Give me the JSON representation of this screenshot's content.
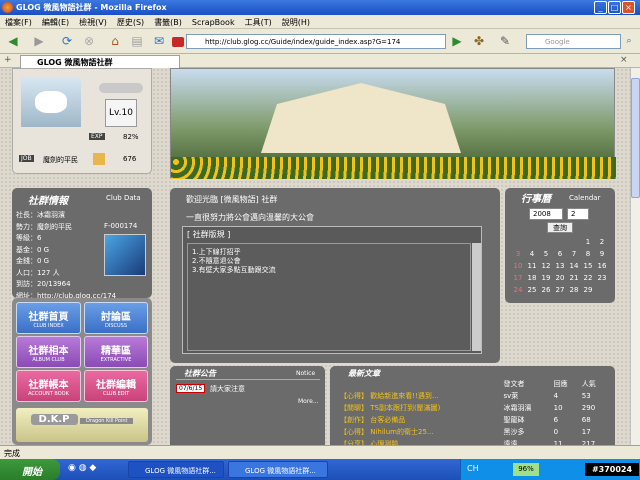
{
  "window": {
    "title": "GLOG 微風物語社群 - Mozilla Firefox",
    "min": "_",
    "max": "□",
    "close": "×"
  },
  "menu": [
    "檔案(F)",
    "編輯(E)",
    "檢視(V)",
    "歷史(S)",
    "書籤(B)",
    "ScrapBook",
    "工具(T)",
    "說明(H)"
  ],
  "nav": {
    "url": "http://club.glog.cc/Guide/index/guide_index.asp?G=174",
    "search_placeholder": "Google"
  },
  "tab": {
    "label": "GLOG 微風物語社群"
  },
  "profile": {
    "level": "Lv.10",
    "exp_label": "EXP",
    "exp_value": "82%",
    "job_label": "JOB",
    "job_name": "魔劍的平民",
    "job_value": "676"
  },
  "club_info": {
    "title": "社群情報",
    "title_en": "Club Data",
    "rows": [
      "社長：冰霜羽濱",
      "勢力：魔劍的平民",
      "等級：6",
      "基金：0 G",
      "金錢：0 G",
      "人口：127 人",
      "到訪：20/13964",
      "網址：http://club.glog.cc/174"
    ],
    "faction_id": "F-000174"
  },
  "nav_buttons": [
    {
      "big": "社群首頁",
      "small": "CLUB INDEX"
    },
    {
      "big": "討論區",
      "small": "DISCUSS"
    },
    {
      "big": "社群相本",
      "small": "ALBUM CLUB"
    },
    {
      "big": "精華區",
      "small": "EXTRACTIVE"
    },
    {
      "big": "社群帳本",
      "small": "ACCOUNT BOOK"
    },
    {
      "big": "社群編輯",
      "small": "CLUB EDIT"
    }
  ],
  "dkp": {
    "title": "D.K.P",
    "sub": "Dragon Kill Point"
  },
  "welcome": {
    "title": "歡迎光臨 [微風物語] 社群",
    "slogan": "一直很努力將公會邁向溫馨的大公會",
    "board_title": "[ 社群版規 ]",
    "rules": [
      "1.上下線打招乎",
      "2.不隨意退公會",
      "3.有壁大家多點互動跟交流"
    ]
  },
  "calendar": {
    "title": "行事曆",
    "title_en": "Calendar",
    "year": "2008",
    "month": "2",
    "query_btn": "查詢",
    "weeks": [
      [
        "",
        "",
        "",
        "",
        "",
        "1",
        "2"
      ],
      [
        "3",
        "4",
        "5",
        "6",
        "7",
        "8",
        "9"
      ],
      [
        "10",
        "11",
        "12",
        "13",
        "14",
        "15",
        "16"
      ],
      [
        "17",
        "18",
        "19",
        "20",
        "21",
        "22",
        "23"
      ],
      [
        "24",
        "25",
        "26",
        "27",
        "28",
        "29",
        ""
      ]
    ]
  },
  "notice": {
    "title": "社群公告",
    "label": "Notice",
    "date": "07/6/15",
    "text": "請大家注意",
    "more": "More..."
  },
  "articles": {
    "title": "最新文章",
    "headers": [
      "",
      "發文者",
      "回應",
      "人氣"
    ],
    "rows": [
      [
        "【心得】 歡給新進來看!!遇到...",
        "sv萊",
        "4",
        "53"
      ],
      [
        "【閒聊】 TS副本跟打到(壓滿圖)",
        "冰霜羽濱",
        "10",
        "290"
      ],
      [
        "【創作】 台客必備品",
        "聖龍砵",
        "6",
        "68"
      ],
      [
        "【心得】 Nihilum的衛士25...",
        "黑沙多",
        "0",
        "17"
      ],
      [
        "【分享】 心理測驗.........",
        "遠遠",
        "11",
        "217"
      ]
    ]
  },
  "status": {
    "text": "完成"
  },
  "taskbar": {
    "start": "開始",
    "tasks": [
      "GLOG 微風物語社群...",
      "GLOG 微風物語社群..."
    ],
    "lang": "CH",
    "battery": "96%",
    "clock": "#370024"
  }
}
